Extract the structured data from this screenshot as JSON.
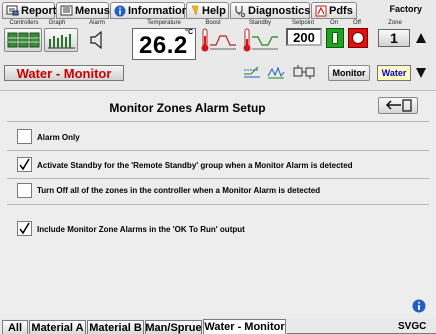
{
  "menu": {
    "tabs": [
      "Reports",
      "Menus",
      "Information",
      "Help",
      "Diagnostics",
      "Pdfs"
    ],
    "factory_label": "Factory"
  },
  "toolbar": {
    "labels": {
      "controllers": "Controllers",
      "graph": "Graph",
      "alarm": "Alarm",
      "temperature": "Temperature",
      "boost": "Boost",
      "standby": "Standby",
      "setpoint": "Setpoint",
      "on": "On",
      "off": "Off",
      "zone": "Zone"
    },
    "temperature_value": "26.2",
    "temperature_unit": "°C",
    "setpoint_value": "200",
    "zone_value": "1",
    "zone_name": "Water - Monitor",
    "monitor_button": "Monitor",
    "water_button": "Water"
  },
  "panel": {
    "title": "Monitor Zones Alarm Setup",
    "options": [
      {
        "label": "Alarm Only",
        "checked": false
      },
      {
        "label": "Activate Standby for the 'Remote Standby' group when a Monitor Alarm is detected",
        "checked": true
      },
      {
        "label": "Turn Off all of the zones in the controller when a Monitor Alarm is detected",
        "checked": false
      },
      {
        "label": "Include Monitor Zone Alarms in the 'OK To Run' output",
        "checked": true
      }
    ]
  },
  "bottom_tabs": [
    "All",
    "Material A",
    "Material B",
    "Man/Sprue",
    "Water - Monitor"
  ],
  "footer_label": "SVGC",
  "colors": {
    "zone_name_text": "#cc0000",
    "on_green": "#1fa31f",
    "off_red": "#e01010",
    "water_button_text": "#0000cc",
    "water_button_bg": "#fff9c4"
  }
}
